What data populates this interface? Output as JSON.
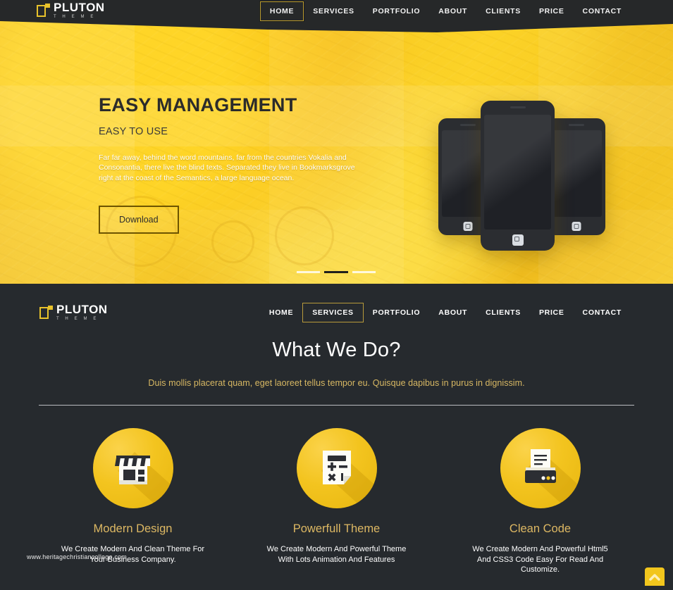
{
  "brand": {
    "name": "PLUTON",
    "tagline": "T  H  E  M  E",
    "icon": "bracket-square-logo-icon"
  },
  "colors": {
    "accent_yellow": "#f2c61d",
    "nav_dark": "#262829",
    "section_dark": "#262a2e",
    "card_title_gold": "#ddb863",
    "subtitle_gold": "#d8b863"
  },
  "top_nav": {
    "items": [
      {
        "label": "HOME",
        "active": true
      },
      {
        "label": "SERVICES",
        "active": false
      },
      {
        "label": "PORTFOLIO",
        "active": false
      },
      {
        "label": "ABOUT",
        "active": false
      },
      {
        "label": "CLIENTS",
        "active": false
      },
      {
        "label": "PRICE",
        "active": false
      },
      {
        "label": "CONTACT",
        "active": false
      }
    ]
  },
  "hero": {
    "title": "EASY MANAGEMENT",
    "subtitle": "EASY TO USE",
    "paragraph": "Far far away, behind the word mountains, far from the countries Vokalia and Consonantia, there live the blind texts. Separated they live in Bookmarksgrove right at the coast of the Semantics, a large language ocean.",
    "button_label": "Download",
    "carousel": {
      "total": 3,
      "active_index": 1
    }
  },
  "sub_nav": {
    "items": [
      {
        "label": "HOME",
        "active": false
      },
      {
        "label": "SERVICES",
        "active": true
      },
      {
        "label": "PORTFOLIO",
        "active": false
      },
      {
        "label": "ABOUT",
        "active": false
      },
      {
        "label": "CLIENTS",
        "active": false
      },
      {
        "label": "PRICE",
        "active": false
      },
      {
        "label": "CONTACT",
        "active": false
      }
    ]
  },
  "services": {
    "heading": "What We Do?",
    "subheading": "Duis mollis placerat quam, eget laoreet tellus tempor eu. Quisque dapibus in purus in dignissim.",
    "cards": [
      {
        "icon": "storefront-icon",
        "title": "Modern Design",
        "text": "We Create Modern And Clean Theme For Your Business Company."
      },
      {
        "icon": "calculator-icon",
        "title": "Powerfull Theme",
        "text": "We Create Modern And Powerful Theme With Lots Animation And Features"
      },
      {
        "icon": "printer-icon",
        "title": "Clean Code",
        "text": "We Create Modern And Powerful Html5 And CSS3 Code Easy For Read And Customize."
      }
    ]
  },
  "watermark": {
    "text": "www.heritagechristiancollege.com"
  },
  "scroll_top": {
    "icon": "chevron-up-icon",
    "label": ""
  }
}
